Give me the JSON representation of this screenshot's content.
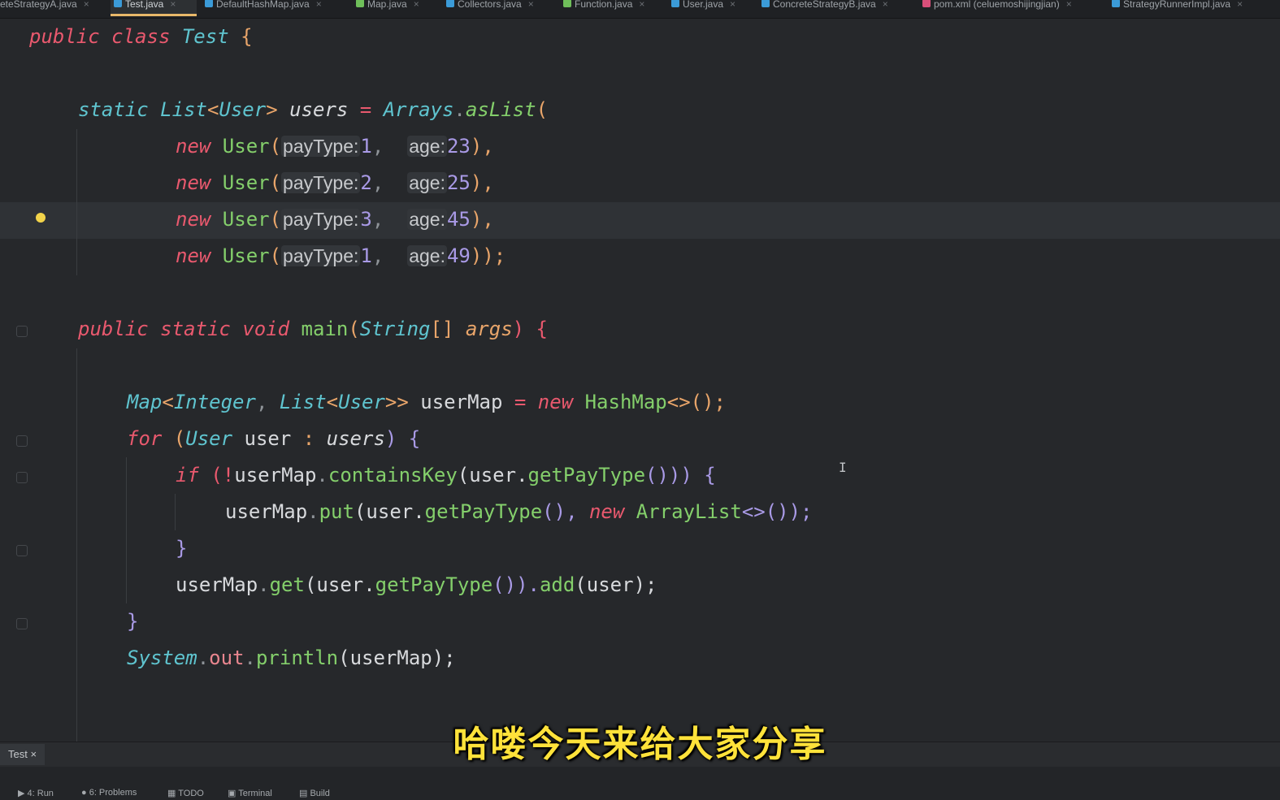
{
  "tabs": [
    {
      "label": "eteStrategyA.java",
      "icon": "java-class-icon",
      "color": "#3b9bd8"
    },
    {
      "label": "Test.java",
      "icon": "java-class-icon",
      "color": "#3b9bd8",
      "active": true
    },
    {
      "label": "DefaultHashMap.java",
      "icon": "java-class-icon",
      "color": "#3b9bd8"
    },
    {
      "label": "Map.java",
      "icon": "interface-icon",
      "color": "#6fbf5a"
    },
    {
      "label": "Collectors.java",
      "icon": "java-class-icon",
      "color": "#3b9bd8"
    },
    {
      "label": "Function.java",
      "icon": "interface-icon",
      "color": "#6fbf5a"
    },
    {
      "label": "User.java",
      "icon": "java-class-icon",
      "color": "#3b9bd8"
    },
    {
      "label": "ConcreteStrategyB.java",
      "icon": "java-class-icon",
      "color": "#3b9bd8"
    },
    {
      "label": "pom.xml (celuemoshijingjian)",
      "icon": "maven-icon",
      "color": "#d94f7a"
    },
    {
      "label": "StrategyRunnerImpl.java",
      "icon": "java-class-icon",
      "color": "#3b9bd8"
    }
  ],
  "code": {
    "l1": {
      "a": "public class ",
      "b": "Test",
      "c": " {"
    },
    "l2": {
      "a": "static ",
      "b": "List",
      "c": "<",
      "d": "User",
      "e": "> ",
      "f": "users",
      "g": " = ",
      "h": "Arrays",
      "i": ".",
      "j": "asList",
      "k": "("
    },
    "users": [
      {
        "kw": "new ",
        "cls": "User",
        "paren": "(",
        "hint1": "payType:",
        "v1": "1",
        "sep": ", ",
        "hint2": "age:",
        "v2": "23",
        "end": "),"
      },
      {
        "kw": "new ",
        "cls": "User",
        "paren": "(",
        "hint1": "payType:",
        "v1": "2",
        "sep": ", ",
        "hint2": "age:",
        "v2": "25",
        "end": "),"
      },
      {
        "kw": "new ",
        "cls": "User",
        "paren": "(",
        "hint1": "payType:",
        "v1": "3",
        "sep": ", ",
        "hint2": "age:",
        "v2": "45",
        "end": "),"
      },
      {
        "kw": "new ",
        "cls": "User",
        "paren": "(",
        "hint1": "payType:",
        "v1": "1",
        "sep": ", ",
        "hint2": "age:",
        "v2": "49",
        "end": "));"
      }
    ],
    "main": {
      "a": "public static void ",
      "b": "main",
      "c": "(",
      "d": "String",
      "e": "[] ",
      "f": "args",
      "g": ") {"
    },
    "map": {
      "a": "Map",
      "b": "<",
      "c": "Integer",
      "d": ", ",
      "e": "List",
      "f": "<",
      "g": "User",
      "h": ">> ",
      "i": "userMap",
      "j": " = ",
      "k": "new ",
      "l": "HashMap",
      "m": "<>();"
    },
    "for": {
      "a": "for ",
      "b": "(",
      "c": "User",
      "d": " user ",
      "e": ": ",
      "f": "users",
      "g": ") {"
    },
    "if": {
      "a": "if ",
      "b": "(!",
      "c": "userMap",
      "d": ".",
      "e": "containsKey",
      "f": "(user.",
      "g": "getPayType",
      "h": "())) {"
    },
    "put": {
      "a": "userMap",
      "b": ".",
      "c": "put",
      "d": "(user.",
      "e": "getPayType",
      "f": "(), ",
      "g": "new ",
      "h": "ArrayList",
      "i": "<>());"
    },
    "close_if": "}",
    "get": {
      "a": "userMap",
      "b": ".",
      "c": "get",
      "d": "(user.",
      "e": "getPayType",
      "f": "()).",
      "g": "add",
      "h": "(user);"
    },
    "close_for": "}",
    "print": {
      "a": "System",
      "b": ".",
      "c": "out",
      "d": ".",
      "e": "println",
      "f": "(userMap);"
    }
  },
  "run_tab": {
    "label": "Test",
    "close": "×"
  },
  "status_items": [
    "4: Run",
    "6: Problems",
    "TODO",
    "Terminal",
    "Build"
  ],
  "subtitle": "哈喽今天来给大家分享"
}
